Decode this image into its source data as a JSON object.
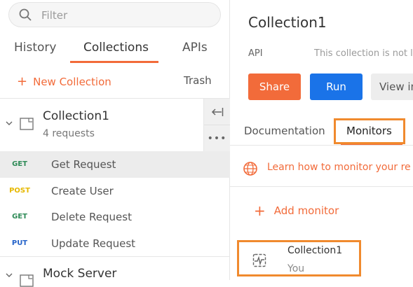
{
  "sidebar": {
    "search": {
      "placeholder": "Filter"
    },
    "tabs": [
      {
        "label": "History"
      },
      {
        "label": "Collections",
        "active": true
      },
      {
        "label": "APIs"
      }
    ],
    "new_collection_label": "New Collection",
    "trash_label": "Trash",
    "collection": {
      "name": "Collection1",
      "count": "4 requests"
    },
    "requests": [
      {
        "method": "GET",
        "name": "Get Request",
        "selected": true
      },
      {
        "method": "POST",
        "name": "Create User"
      },
      {
        "method": "GET",
        "name": "Delete Request"
      },
      {
        "method": "PUT",
        "name": "Update Request"
      }
    ],
    "mock_server": {
      "name": "Mock Server"
    }
  },
  "main": {
    "title": "Collection1",
    "api_label": "API",
    "api_desc": "This collection is not li",
    "buttons": {
      "share": "Share",
      "run": "Run",
      "view": "View in"
    },
    "tabs": [
      {
        "label": "Documentation"
      },
      {
        "label": "Monitors",
        "active": true
      }
    ],
    "learn_text": "Learn how to monitor your re",
    "add_monitor_label": "Add monitor",
    "monitor_item": {
      "name": "Collection1",
      "owner": "You"
    }
  },
  "colors": {
    "accent": "#f26b3a",
    "primary": "#1a73e8",
    "highlight_box": "#f08a2e",
    "get": "#2e8b57",
    "post": "#e6b800",
    "put": "#2563c9"
  }
}
